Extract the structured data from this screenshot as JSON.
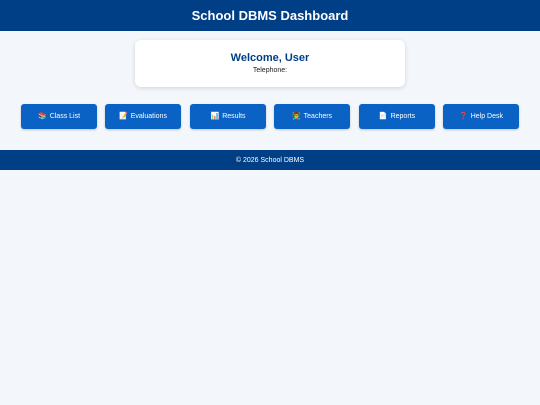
{
  "header": {
    "title": "School DBMS Dashboard"
  },
  "welcome": {
    "title": "Welcome, User",
    "telephone_label": "Telephone:"
  },
  "nav": {
    "items": [
      {
        "icon": "📚",
        "icon_name": "books-icon",
        "label": "Class List"
      },
      {
        "icon": "📝",
        "icon_name": "memo-icon",
        "label": "Evaluations"
      },
      {
        "icon": "📊",
        "icon_name": "bar-chart-icon",
        "label": "Results"
      },
      {
        "icon": "👨‍🏫",
        "icon_name": "teacher-icon",
        "label": "Teachers"
      },
      {
        "icon": "📄",
        "icon_name": "document-icon",
        "label": "Reports"
      },
      {
        "icon": "❓",
        "icon_name": "question-icon",
        "label": "Help Desk"
      }
    ]
  },
  "footer": {
    "text": "© 2026 School DBMS"
  },
  "colors": {
    "header_bg": "#003f86",
    "button_bg": "#0a63c4",
    "page_bg": "#f3f6fa"
  }
}
